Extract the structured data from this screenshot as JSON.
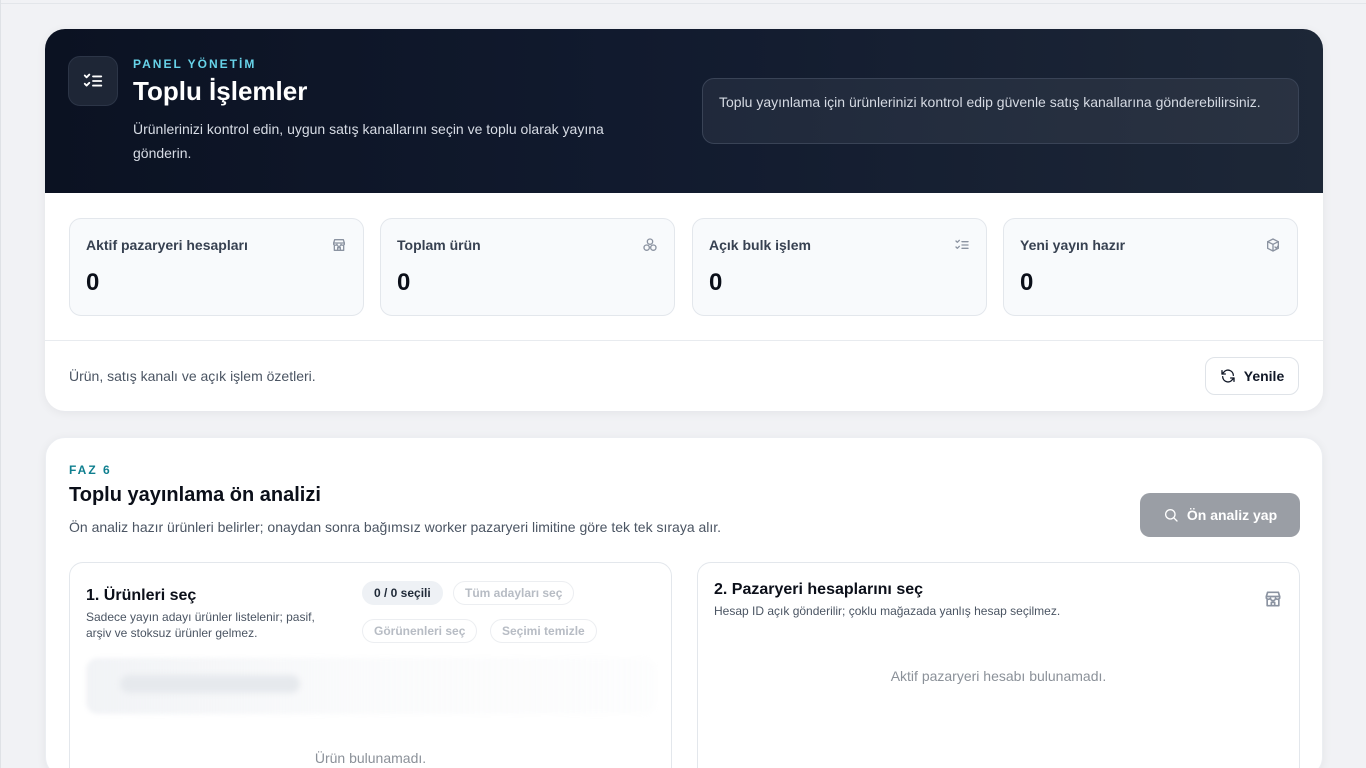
{
  "header": {
    "eyebrow": "PANEL YÖNETİM",
    "title": "Toplu İşlemler",
    "description": "Ürünlerinizi kontrol edin, uygun satış kanallarını seçin ve toplu olarak yayına gönderin.",
    "note": "Toplu yayınlama için ürünlerinizi kontrol edip güvenle satış kanallarına gönderebilirsiniz.",
    "icon": "checklist-icon"
  },
  "stats": [
    {
      "label": "Aktif pazaryeri hesapları",
      "value": "0",
      "icon": "store-icon"
    },
    {
      "label": "Toplam ürün",
      "value": "0",
      "icon": "boxes-icon"
    },
    {
      "label": "Açık bulk işlem",
      "value": "0",
      "icon": "list-check-icon"
    },
    {
      "label": "Yeni yayın hazır",
      "value": "0",
      "icon": "package-check-icon"
    }
  ],
  "summary": {
    "text": "Ürün, satış kanalı ve açık işlem özetleri.",
    "refresh_label": "Yenile"
  },
  "phase": {
    "eyebrow": "FAZ 6",
    "title": "Toplu yayınlama ön analizi",
    "description": "Ön analiz hazır ürünleri belirler; onaydan sonra bağımsız worker pazaryeri limitine göre tek tek sıraya alır.",
    "analyze_label": "Ön analiz yap"
  },
  "products_panel": {
    "title": "1. Ürünleri seç",
    "subtitle": "Sadece yayın adayı ürünler listelenir; pasif, arşiv ve stoksuz ürünler gelmez.",
    "selected_count": "0 / 0 seçili",
    "select_all_label": "Tüm adayları seç",
    "select_visible_label": "Görünenleri seç",
    "clear_label": "Seçimi temizle",
    "empty": "Ürün bulunamadı."
  },
  "accounts_panel": {
    "title": "2. Pazaryeri hesaplarını seç",
    "subtitle": "Hesap ID açık gönderilir; çoklu mağazada yanlış hesap seçilmez.",
    "empty": "Aktif pazaryeri hesabı bulunamadı."
  },
  "colors": {
    "hero_bg": "#0b1222",
    "accent": "#67d3e9",
    "phase_accent": "#0f7f8f",
    "disabled_button": "#9a9ea5"
  }
}
